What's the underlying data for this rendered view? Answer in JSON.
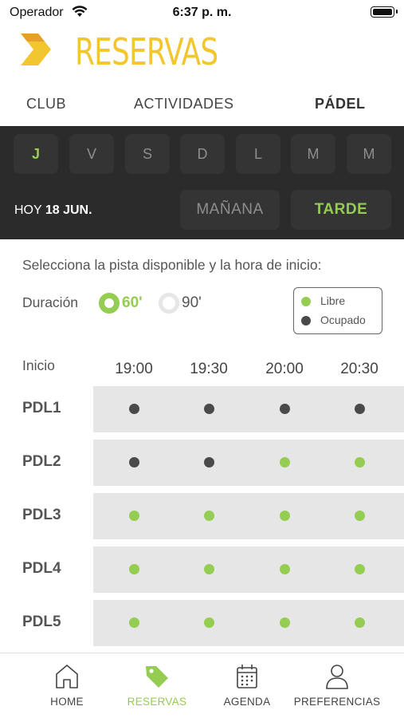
{
  "status_bar": {
    "carrier": "Operador",
    "time": "6:37 p. m."
  },
  "header": {
    "title": "RESERVAS"
  },
  "tabs": [
    {
      "label": "CLUB",
      "active": false
    },
    {
      "label": "ACTIVIDADES",
      "active": false
    },
    {
      "label": "PÁDEL",
      "active": true
    }
  ],
  "days": [
    {
      "label": "J",
      "active": true
    },
    {
      "label": "V",
      "active": false
    },
    {
      "label": "S",
      "active": false
    },
    {
      "label": "D",
      "active": false
    },
    {
      "label": "L",
      "active": false
    },
    {
      "label": "M",
      "active": false
    },
    {
      "label": "M",
      "active": false
    }
  ],
  "date": {
    "prefix": "HOY",
    "value": "18 JUN."
  },
  "shifts": [
    {
      "label": "MAÑANA",
      "active": false
    },
    {
      "label": "TARDE",
      "active": true
    }
  ],
  "instructions": "Selecciona la pista disponible y la hora de inicio:",
  "duration": {
    "label": "Duración",
    "options": [
      {
        "label": "60'",
        "selected": true
      },
      {
        "label": "90'",
        "selected": false
      }
    ]
  },
  "legend": {
    "free": {
      "label": "Libre",
      "color": "#95cc52"
    },
    "busy": {
      "label": "Ocupado",
      "color": "#4a4a4a"
    }
  },
  "schedule": {
    "start_label": "Inicio",
    "times": [
      "19:00",
      "19:30",
      "20:00",
      "20:30"
    ],
    "courts": [
      {
        "name": "PDL1",
        "slots": [
          "busy",
          "busy",
          "busy",
          "busy"
        ]
      },
      {
        "name": "PDL2",
        "slots": [
          "busy",
          "busy",
          "free",
          "free"
        ]
      },
      {
        "name": "PDL3",
        "slots": [
          "free",
          "free",
          "free",
          "free"
        ]
      },
      {
        "name": "PDL4",
        "slots": [
          "free",
          "free",
          "free",
          "free"
        ]
      },
      {
        "name": "PDL5",
        "slots": [
          "free",
          "free",
          "free",
          "free"
        ]
      }
    ]
  },
  "colors": {
    "accent": "#95cc52",
    "brand": "#f2c62e",
    "panel": "#2b2b2b"
  },
  "tabbar": [
    {
      "label": "HOME",
      "icon": "home-icon",
      "active": false
    },
    {
      "label": "RESERVAS",
      "icon": "tag-icon",
      "active": true
    },
    {
      "label": "AGENDA",
      "icon": "calendar-icon",
      "active": false
    },
    {
      "label": "PREFERENCIAS",
      "icon": "user-icon",
      "active": false
    }
  ]
}
